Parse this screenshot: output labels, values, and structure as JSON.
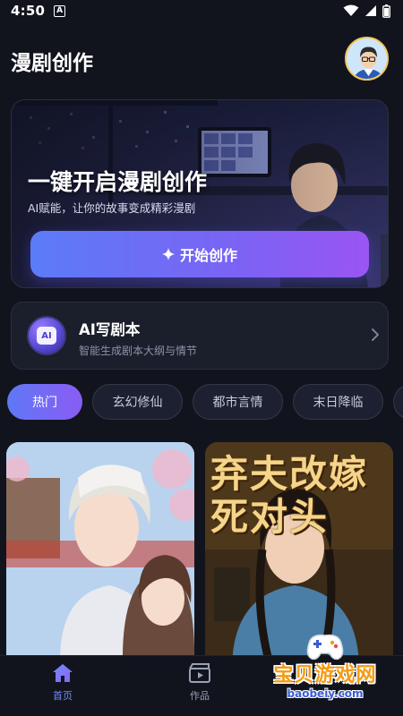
{
  "status_bar": {
    "time": "4:50",
    "notification_glyph": "A",
    "icons": [
      "wifi-icon",
      "signal-icon",
      "battery-icon"
    ]
  },
  "header": {
    "title": "漫剧创作",
    "avatar_icon": "user-avatar"
  },
  "hero": {
    "title": "一键开启漫剧创作",
    "subtitle": "AI赋能，让你的故事变成精彩漫剧",
    "button_label": "开始创作",
    "button_icon": "sparkle-icon"
  },
  "ai_card": {
    "icon_text": "AI",
    "title": "AI写剧本",
    "subtitle": "智能生成剧本大纲与情节",
    "chevron_icon": "chevron-right-icon"
  },
  "genre_tabs": [
    {
      "label": "热门",
      "active": true
    },
    {
      "label": "玄幻修仙",
      "active": false
    },
    {
      "label": "都市言情",
      "active": false
    },
    {
      "label": "末日降临",
      "active": false
    },
    {
      "label": "",
      "active": false
    }
  ],
  "cards": [
    {
      "poster_title": ""
    },
    {
      "poster_title": "弃夫改嫁死对头"
    }
  ],
  "bottom_nav": [
    {
      "label": "首页",
      "icon": "home-icon",
      "active": true
    },
    {
      "label": "作品",
      "icon": "film-icon",
      "active": false
    }
  ],
  "watermark": {
    "text": "宝贝游戏网",
    "url": "baobeiy.com"
  },
  "colors": {
    "background": "#12141d",
    "accent_start": "#5b7cf7",
    "accent_end": "#9a55f2",
    "active_nav": "#6f8cff"
  }
}
